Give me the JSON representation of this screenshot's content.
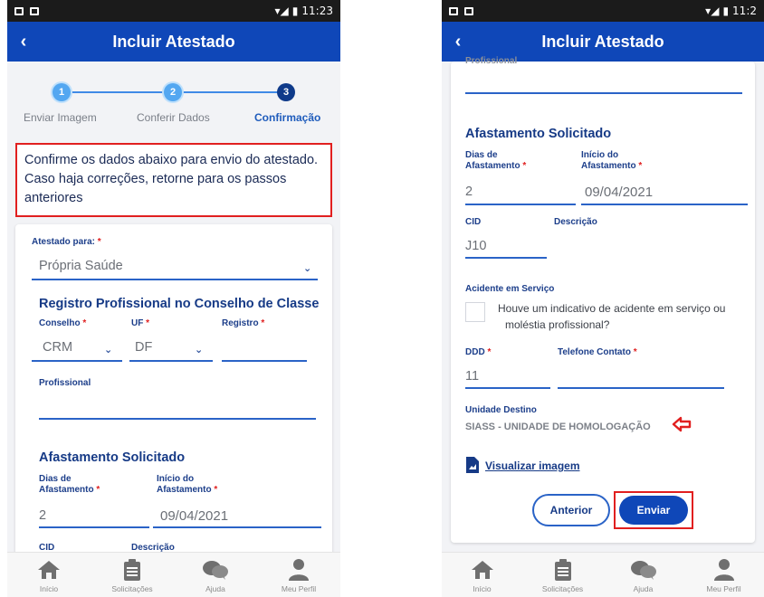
{
  "status_bar": {
    "time": "11:23",
    "time_right": "11:2"
  },
  "app_bar": {
    "title": "Incluir Atestado",
    "back": "‹"
  },
  "stepper": [
    {
      "number": "1",
      "label": "Enviar Imagem",
      "state": "done"
    },
    {
      "number": "2",
      "label": "Conferir Dados",
      "state": "done"
    },
    {
      "number": "3",
      "label": "Confirmação",
      "state": "active"
    }
  ],
  "notice": "Confirme os dados abaixo para envio do atestado. Caso haja correções, retorne para os passos anteriores",
  "form": {
    "atestado_para": {
      "label": "Atestado para:",
      "value": "Própria Saúde"
    },
    "registro_section": "Registro Profissional no Conselho de Classe",
    "conselho": {
      "label": "Conselho",
      "value": "CRM"
    },
    "uf": {
      "label": "UF",
      "value": "DF"
    },
    "registro": {
      "label": "Registro",
      "value": ""
    },
    "profissional": {
      "label": "Profissional",
      "value": "",
      "label_cut": "Profissional"
    },
    "afastamento_section": "Afastamento Solicitado",
    "dias": {
      "label_1": "Dias de",
      "label_2": "Afastamento",
      "value": "2"
    },
    "inicio": {
      "label_1": "Início do",
      "label_2": "Afastamento",
      "value": "09/04/2021"
    },
    "cid": {
      "label": "CID",
      "value": "J10"
    },
    "descricao": {
      "label": "Descrição",
      "value": ""
    },
    "acidente": {
      "label": "Acidente em Serviço",
      "question_1": "Houve um indicativo de acidente em serviço ou",
      "question_2": "moléstia profissional?"
    },
    "ddd": {
      "label": "DDD",
      "value": "11"
    },
    "telefone": {
      "label": "Telefone Contato",
      "value": ""
    },
    "unidade": {
      "label": "Unidade Destino",
      "value": "SIASS - UNIDADE DE HOMOLOGAÇÃO"
    },
    "visualizar": "Visualizar imagem"
  },
  "required_mark": "*",
  "buttons": {
    "anterior": "Anterior",
    "enviar": "Enviar"
  },
  "bottom_nav": [
    {
      "label": "Início",
      "icon": "home-icon"
    },
    {
      "label": "Solicitações",
      "icon": "clipboard-icon"
    },
    {
      "label": "Ajuda",
      "icon": "chat-icon"
    },
    {
      "label": "Meu Perfil",
      "icon": "person-icon"
    }
  ],
  "colors": {
    "app_bar": "#0f47b8",
    "accent": "#2a63c7",
    "highlight": "#e11f1f"
  }
}
